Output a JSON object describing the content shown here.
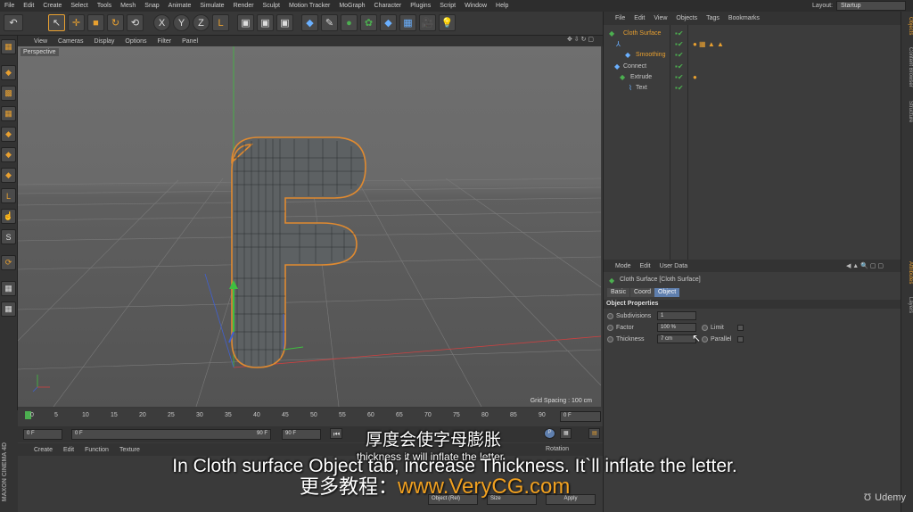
{
  "menubar": {
    "items": [
      "File",
      "Edit",
      "Create",
      "Select",
      "Tools",
      "Mesh",
      "Snap",
      "Animate",
      "Simulate",
      "Render",
      "Sculpt",
      "Motion Tracker",
      "MoGraph",
      "Character",
      "Plugins",
      "Script",
      "Window",
      "Help"
    ],
    "layout_label": "Layout:",
    "layout_value": "Startup"
  },
  "viewport": {
    "menu": [
      "View",
      "Cameras",
      "Display",
      "Options",
      "Filter",
      "Panel"
    ],
    "label": "Perspective",
    "grid_spacing": "Grid Spacing : 100 cm"
  },
  "timeline": {
    "ticks": [
      "0",
      "5",
      "10",
      "15",
      "20",
      "25",
      "30",
      "35",
      "40",
      "45",
      "50",
      "55",
      "60",
      "65",
      "70",
      "75",
      "80",
      "85",
      "90"
    ],
    "current_frame": "0 F"
  },
  "transport": {
    "start": "0 F",
    "start2": "0 F",
    "end": "90 F",
    "end2": "90 F"
  },
  "material_manager": {
    "menu": [
      "Create",
      "Edit",
      "Function",
      "Texture"
    ],
    "rotation_label": "Rotation"
  },
  "coord_manager": {
    "mode_select": "Object (Rel)",
    "size_select": "Size",
    "apply_label": "Apply"
  },
  "object_manager": {
    "menu": [
      "File",
      "Edit",
      "View",
      "Objects",
      "Tags",
      "Bookmarks"
    ],
    "objects": [
      {
        "name": "Cloth Surface",
        "color": "#e8a030"
      },
      {
        "name": "Smoothing",
        "color": "#e8a030"
      },
      {
        "name": "Connect",
        "color": "#c8c8c8"
      },
      {
        "name": "Extrude",
        "color": "#c8c8c8"
      },
      {
        "name": "Text",
        "color": "#c8c8c8"
      }
    ]
  },
  "attribute_manager": {
    "menu": [
      "Mode",
      "Edit",
      "User Data"
    ],
    "title": "Cloth Surface [Cloth Surface]",
    "tabs": [
      "Basic",
      "Coord",
      "Object"
    ],
    "section": "Object Properties",
    "subdivisions_label": "Subdivisions",
    "subdivisions_value": "1",
    "factor_label": "Factor",
    "factor_value": "100 %",
    "thickness_label": "Thickness",
    "thickness_value": "7 cm",
    "limit_label": "Limit",
    "parallel_label": "Parallel"
  },
  "side_tabs": [
    "Objects",
    "Content Browser",
    "Structure",
    "Attributes",
    "Layers"
  ],
  "subtitles": {
    "chinese_top": "厚度会使字母膨胀",
    "english_small": "thickness it will inflate the letter",
    "english_main": "In Cloth surface Object tab, increase Thickness. It`ll inflate the letter.",
    "chinese_bottom": "更多教程：",
    "site": "www.VeryCG.com"
  },
  "watermarks": {
    "maxon": "MAXON CINEMA 4D",
    "udemy": "Udemy"
  },
  "colors": {
    "accent_orange": "#e8a030",
    "active_tab": "#5f7fae",
    "check_green": "#4caf50",
    "site_orange": "#f0a020"
  }
}
